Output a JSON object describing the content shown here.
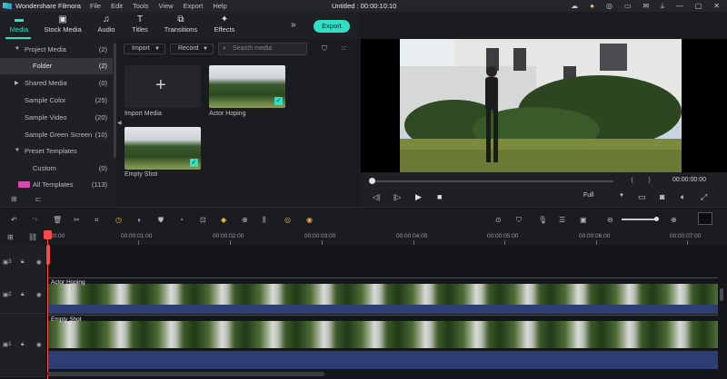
{
  "app": {
    "name": "Wondershare Filmora",
    "doc_title": "Untitled : 00:00:10:10"
  },
  "menu": [
    "File",
    "Edit",
    "Tools",
    "View",
    "Export",
    "Help"
  ],
  "top_tabs": [
    {
      "label": "Media",
      "icon": "folder-icon",
      "active": true
    },
    {
      "label": "Stock Media",
      "icon": "stock-media-icon"
    },
    {
      "label": "Audio",
      "icon": "music-note-icon"
    },
    {
      "label": "Titles",
      "icon": "text-title-icon"
    },
    {
      "label": "Transitions",
      "icon": "transitions-icon"
    },
    {
      "label": "Effects",
      "icon": "effects-sparkle-icon"
    }
  ],
  "export_label": "Export",
  "sidebar": {
    "items": [
      {
        "label": "Project Media",
        "count": "(2)",
        "arrow": "▼"
      },
      {
        "label": "Folder",
        "count": "(2)",
        "selected": true
      },
      {
        "label": "Shared Media",
        "count": "(0)",
        "arrow": "▶"
      },
      {
        "label": "Sample Color",
        "count": "(25)"
      },
      {
        "label": "Sample Video",
        "count": "(20)"
      },
      {
        "label": "Sample Green Screen",
        "count": "(10)"
      },
      {
        "label": "Preset Templates",
        "count": "",
        "arrow": "▼"
      },
      {
        "label": "Custom",
        "count": "(0)"
      },
      {
        "label": "All Templates",
        "count": "(113)"
      }
    ]
  },
  "media_toolbar": {
    "import": "Import",
    "record": "Record",
    "search_placeholder": "Search media"
  },
  "media_items": [
    {
      "label": "Import Media"
    },
    {
      "label": "Actor Hoping"
    },
    {
      "label": "Empty Shot"
    }
  ],
  "player": {
    "timecode": "00:00:00:00",
    "quality": "Full"
  },
  "ruler": [
    "00:00",
    "00:00:01:00",
    "00:00:02:00",
    "00:00:03:00",
    "00:00:04:00",
    "00:00:05:00",
    "00:00:06:00",
    "00:00:07:00"
  ],
  "tracks": [
    {
      "label": "3"
    },
    {
      "label": "2",
      "clip": "Actor Hoping"
    },
    {
      "label": "1",
      "clip": "Empty Shot"
    }
  ],
  "colors": {
    "accent": "#2fe0c6",
    "playhead": "#ff4a4a"
  }
}
